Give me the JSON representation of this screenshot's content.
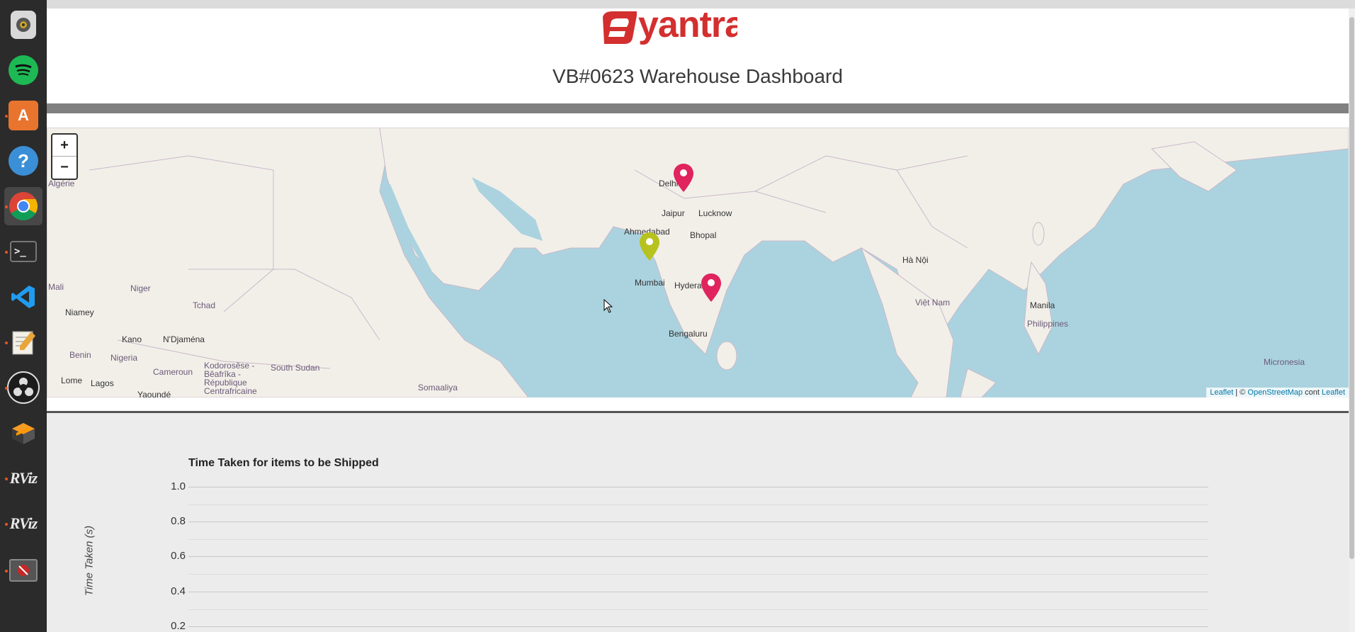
{
  "dock": {
    "items": [
      {
        "name": "rhythmbox",
        "icon": "speaker-icon"
      },
      {
        "name": "spotify",
        "icon": "spotify-icon"
      },
      {
        "name": "software-center",
        "icon": "shopping-bag-icon",
        "glyph": "A"
      },
      {
        "name": "help",
        "icon": "help-icon",
        "glyph": "?"
      },
      {
        "name": "chrome",
        "icon": "chrome-icon"
      },
      {
        "name": "terminal",
        "icon": "terminal-icon",
        "glyph": ">_"
      },
      {
        "name": "vscode",
        "icon": "vscode-icon"
      },
      {
        "name": "text-editor",
        "icon": "text-editor-icon"
      },
      {
        "name": "obs",
        "icon": "obs-icon"
      },
      {
        "name": "sublime",
        "icon": "sublime-icon"
      },
      {
        "name": "rviz-1",
        "icon": "rviz-icon",
        "label": "RViz"
      },
      {
        "name": "rviz-2",
        "icon": "rviz-icon",
        "label": "RViz"
      },
      {
        "name": "app",
        "icon": "blocked-icon"
      }
    ]
  },
  "header": {
    "logo_text": "eyantra",
    "title": "VB#0623 Warehouse Dashboard"
  },
  "map": {
    "zoom_in": "+",
    "zoom_out": "−",
    "attribution": {
      "leaflet": "Leaflet",
      "sep": " | © ",
      "osm": "OpenStreetMap",
      "rest": " cont",
      "leaflet2": "Leaflet"
    },
    "cities": [
      "Delhi",
      "Jaipur",
      "Lucknow",
      "Ahmedabad",
      "Bhopal",
      "Mumbai",
      "Hyderabad",
      "Bengaluru",
      "Niger",
      "Tchad",
      "Niamey",
      "Kano",
      "N'Djaména",
      "Benin",
      "Nigeria",
      "Cameroun",
      "Lome",
      "Lagos",
      "Yaoundé",
      "South Sudan",
      "Somaaliya",
      "Kodorosêse - Bêafrîka - République Centrafricaine",
      "Mali",
      "Hà Nội",
      "Việt Nam",
      "Manila",
      "Philippines",
      "Micronesia",
      "Algérie"
    ],
    "markers": [
      {
        "city": "Delhi",
        "color": "#e0245e"
      },
      {
        "city": "Mumbai",
        "color": "#b8c21e"
      },
      {
        "city": "Chennai",
        "color": "#e0245e"
      }
    ]
  },
  "chart_data": {
    "type": "line",
    "title": "Time Taken for items to be Shipped",
    "ylabel": "Time Taken (s)",
    "yticks": [
      "1.0",
      "0.8",
      "0.6",
      "0.4",
      "0.2"
    ],
    "ylim": [
      0,
      1
    ],
    "series": []
  }
}
